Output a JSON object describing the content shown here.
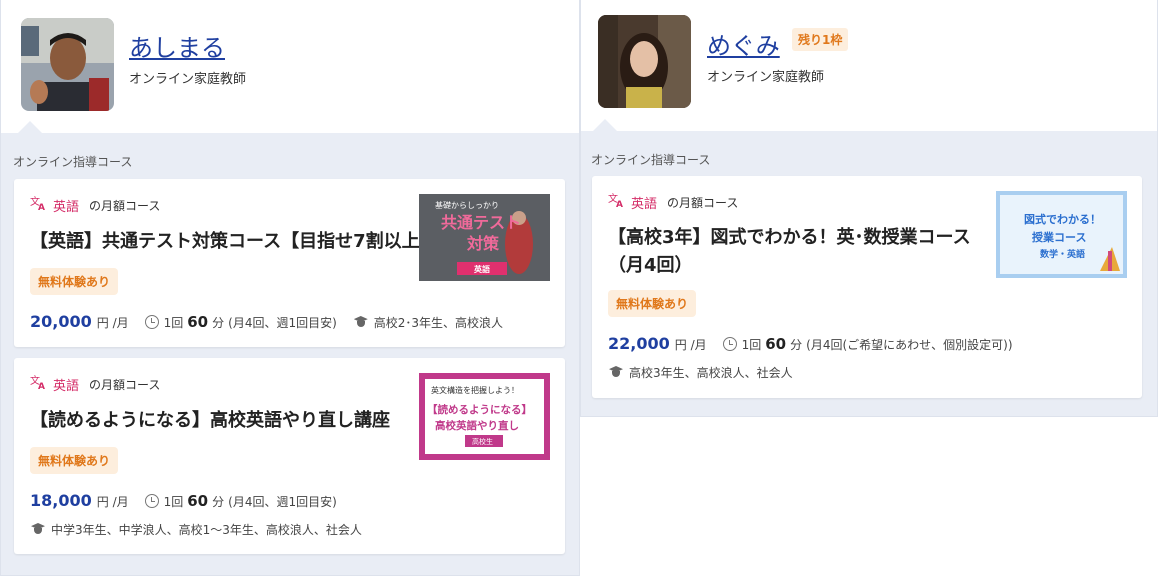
{
  "left_tutor": {
    "name": "あしまる",
    "role": "オンライン家庭教師",
    "section_title": "オンライン指導コース",
    "courses": [
      {
        "subject": "英語",
        "plan": "の月額コース",
        "title": "【英語】共通テスト対策コース【目指せ7割以上】",
        "trial": "無料体験あり",
        "price": "20,000",
        "price_unit": "円 /月",
        "per": "1回",
        "minutes": "60",
        "minutes_unit": "分",
        "frequency": "(月4回、週1回目安)",
        "target": "高校2･3年生、高校浪人",
        "thumb": {
          "line1": "基礎からしっかり",
          "line2": "共通テスト",
          "line3": "対策",
          "tag": "英語"
        }
      },
      {
        "subject": "英語",
        "plan": "の月額コース",
        "title": "【読めるようになる】高校英語やり直し講座",
        "trial": "無料体験あり",
        "price": "18,000",
        "price_unit": "円 /月",
        "per": "1回",
        "minutes": "60",
        "minutes_unit": "分",
        "frequency": "(月4回、週1回目安)",
        "target": "中学3年生、中学浪人、高校1～3年生、高校浪人、社会人",
        "thumb": {
          "line1": "英文構造を把握しよう！",
          "line2": "【読めるようになる】",
          "line3": "高校英語やり直し",
          "tag": "高校生"
        }
      }
    ]
  },
  "right_tutor": {
    "name": "めぐみ",
    "badge": "残り1枠",
    "role": "オンライン家庭教師",
    "section_title": "オンライン指導コース",
    "courses": [
      {
        "subject": "英語",
        "plan": "の月額コース",
        "title_line1": "【高校3年】図式でわかる！英･数授業コース",
        "title_line2": "（月4回）",
        "trial": "無料体験あり",
        "price": "22,000",
        "price_unit": "円 /月",
        "per": "1回",
        "minutes": "60",
        "minutes_unit": "分",
        "frequency": "(月4回(ご希望にあわせ、個別設定可))",
        "target": "高校3年生、高校浪人、社会人",
        "thumb": {
          "line1": "図式でわかる！",
          "line2": "授業コース",
          "line3": "数学・英語"
        }
      }
    ]
  },
  "colors": {
    "accent_blue": "#1f3fa0",
    "subject_pink": "#d42c67",
    "trial_orange": "#e0781b",
    "panel_bg": "#e9edf5"
  },
  "icons": [
    "translate-icon",
    "clock-icon",
    "graduation-cap-icon"
  ]
}
